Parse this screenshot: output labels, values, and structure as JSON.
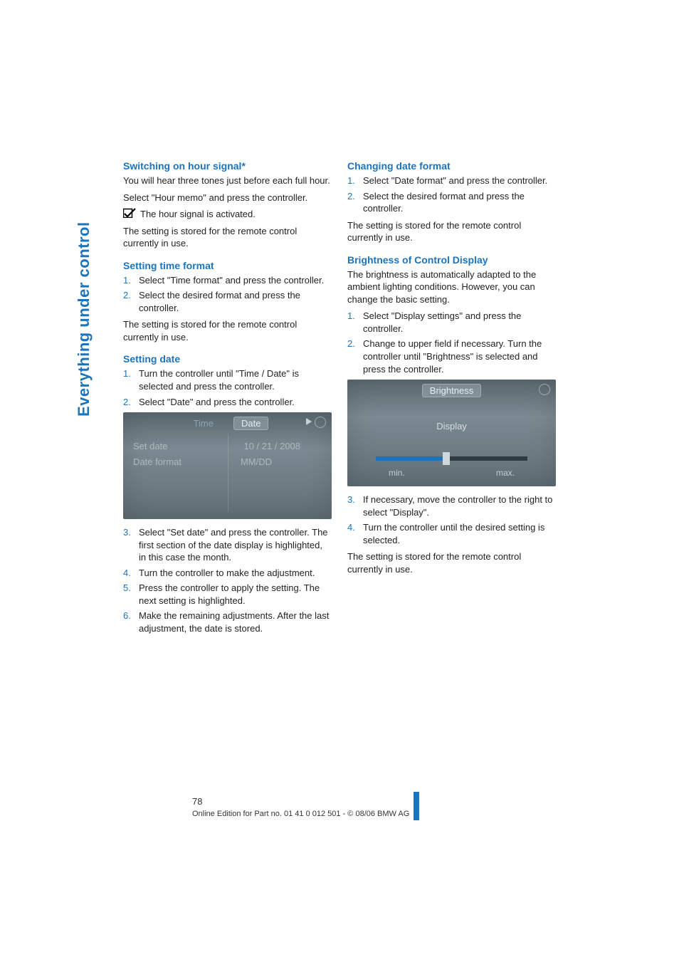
{
  "sideTab": "Everything under control",
  "pageNumber": "78",
  "footerLine": "Online Edition for Part no. 01 41 0 012 501 - © 08/06 BMW AG",
  "left": {
    "h1": "Switching on hour signal*",
    "p1a": "You will hear three tones just before each full hour.",
    "p1b": "Select \"Hour memo\" and press the controller.",
    "p1c": "The hour signal is activated.",
    "p1d": "The setting is stored for the remote control currently in use.",
    "h2": "Setting time format",
    "l2": {
      "i1": "Select \"Time format\" and press the controller.",
      "i2": "Select the desired format and press the controller."
    },
    "p2a": "The setting is stored for the remote control currently in use.",
    "h3": "Setting date",
    "l3a": {
      "i1": "Turn the controller until \"Time / Date\" is selected and press the controller.",
      "i2": "Select \"Date\" and press the controller."
    },
    "sc": {
      "tabTime": "Time",
      "tabDate": "Date",
      "rowSetDateLabel": "Set date",
      "rowSetDateValue": "10 / 21 / 2008",
      "rowFormatLabel": "Date format",
      "rowFormatValue": "MM/DD"
    },
    "l3b": {
      "i3": "Select \"Set date\" and press the controller. The first section of the date display is highlighted, in this case the month.",
      "i4": "Turn the controller to make the adjustment.",
      "i5": "Press the controller to apply the setting. The next setting is highlighted.",
      "i6": "Make the remaining adjustments. After the last adjustment, the date is stored."
    }
  },
  "right": {
    "h1": "Changing date format",
    "l1": {
      "i1": "Select \"Date format\" and press the controller.",
      "i2": "Select the desired format and press the controller."
    },
    "p1a": "The setting is stored for the remote control currently in use.",
    "h2": "Brightness of Control Display",
    "p2a": "The brightness is automatically adapted to the ambient lighting conditions. However, you can change the basic setting.",
    "l2a": {
      "i1": "Select \"Display settings\" and press the controller.",
      "i2": "Change to upper field if necessary. Turn the controller until \"Brightness\" is selected and press the controller."
    },
    "sc": {
      "title": "Brightness",
      "display": "Display",
      "min": "min.",
      "max": "max."
    },
    "l2b": {
      "i3": "If necessary, move the controller to the right to select \"Display\".",
      "i4": "Turn the controller until the desired setting is selected."
    },
    "p2b": "The setting is stored for the remote control currently in use."
  },
  "nums": {
    "n1": "1.",
    "n2": "2.",
    "n3": "3.",
    "n4": "4.",
    "n5": "5.",
    "n6": "6."
  }
}
